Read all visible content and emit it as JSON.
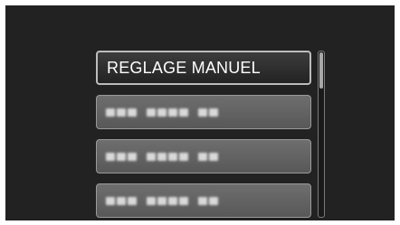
{
  "menu": {
    "items": [
      {
        "label": "REGLAGE MANUEL",
        "selected": true
      },
      {
        "label": "",
        "blurred": true,
        "selected": false
      },
      {
        "label": "",
        "blurred": true,
        "selected": false
      },
      {
        "label": "",
        "blurred": true,
        "selected": false
      }
    ]
  },
  "scrollbar": {
    "position": "top"
  }
}
